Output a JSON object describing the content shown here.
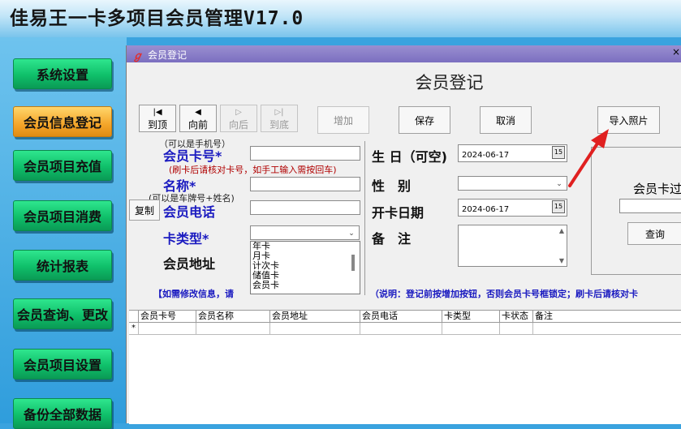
{
  "app_title": "佳易王一卡多项目会员管理V17.0",
  "nav": [
    {
      "label": "系统设置",
      "active": false
    },
    {
      "label": "会员信息登记",
      "active": true
    },
    {
      "label": "会员项目充值",
      "active": false
    },
    {
      "label": "会员项目消费",
      "active": false
    },
    {
      "label": "统计报表",
      "active": false
    },
    {
      "label": "会员查询、更改",
      "active": false
    },
    {
      "label": "会员项目设置",
      "active": false
    },
    {
      "label": "备份全部数据",
      "active": false
    }
  ],
  "window": {
    "title": "会员登记",
    "close_glyph": "×",
    "heading": "会员登记"
  },
  "record_nav": {
    "first": "到顶",
    "prev": "向前",
    "next": "向后",
    "last": "到底"
  },
  "buttons": {
    "add": "增加",
    "save": "保存",
    "cancel": "取消",
    "import_photo": "导入照片",
    "copy": "复制",
    "search": "查询"
  },
  "form": {
    "hint_phone": "（可以是手机号）",
    "card_no_label": "会员卡号*",
    "swipe_hint": "(刷卡后请核对卡号，如手工输入需按回车)",
    "name_label": "名称*",
    "hint_plate": "(可以是车牌号+姓名)",
    "phone_label": "会员电话",
    "card_type_label": "卡类型*",
    "address_label": "会员地址",
    "birthday_label": "生 日（可空)",
    "birthday_value": "2024-06-17",
    "gender_label": "性　别",
    "open_date_label": "开卡日期",
    "open_date_value": "2024-06-17",
    "remark_label": "备　注",
    "card_types": [
      "年卡",
      "月卡",
      "计次卡",
      "储值卡",
      "会员卡"
    ],
    "right_panel_label": "会员卡过"
  },
  "notice": {
    "left": "【如需修改信息，请",
    "right": "（说明：登记前按增加按钮，否则会员卡号框锁定；刷卡后请核对卡"
  },
  "grid": {
    "columns": [
      "会员卡号",
      "会员名称",
      "会员地址",
      "会员电话",
      "卡类型",
      "卡状态",
      "备注"
    ],
    "new_row_marker": "*"
  },
  "colors": {
    "nav_green": "#12c873",
    "nav_active": "#f4a52a",
    "label_blue": "#1a1ac0",
    "arrow_red": "#e02020"
  }
}
